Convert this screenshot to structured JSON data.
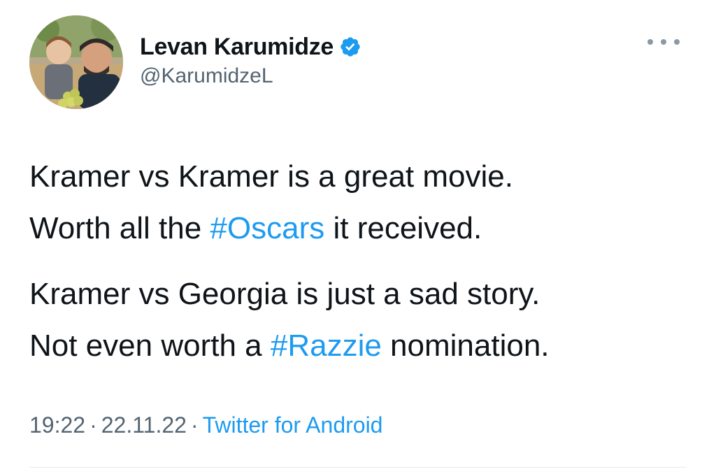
{
  "author": {
    "display_name": "Levan Karumidze",
    "handle": "@KarumidzeL",
    "verified": true,
    "avatar": "profile-photo"
  },
  "tweet": {
    "paragraphs": [
      {
        "line1": "Kramer vs Kramer is a great movie.",
        "pre": "Worth all the ",
        "hashtag": "#Oscars",
        "post": " it received."
      },
      {
        "line1": "Kramer vs Georgia is just a sad story.",
        "pre": "Not even worth a ",
        "hashtag": "#Razzie",
        "post": " nomination."
      }
    ]
  },
  "meta": {
    "time": "19:22",
    "separator": "·",
    "date": "22.11.22",
    "source": "Twitter for Android"
  },
  "colors": {
    "link": "#1d9bf0",
    "text": "#0f1419",
    "secondary": "#536471",
    "verified_badge": "#1d9bf0"
  },
  "icons": {
    "verified": "verified-badge-icon",
    "more": "more-options-icon"
  }
}
